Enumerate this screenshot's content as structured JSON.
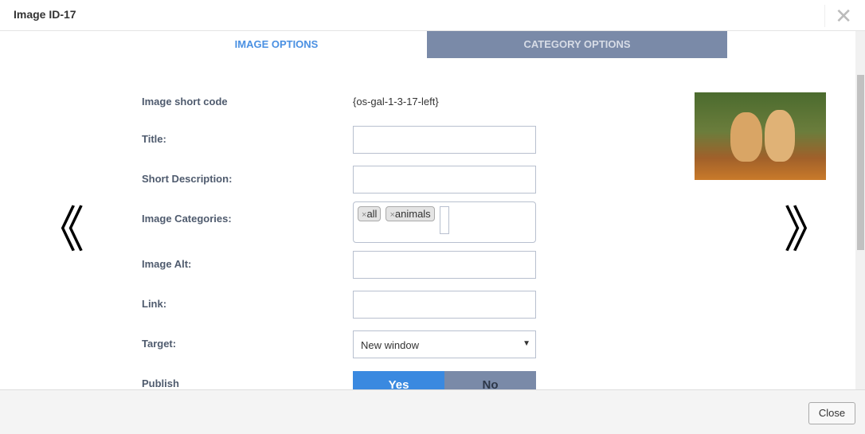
{
  "title": "Image ID-17",
  "tabs": [
    {
      "label": "IMAGE OPTIONS",
      "active": true
    },
    {
      "label": "CATEGORY OPTIONS",
      "active": false
    }
  ],
  "fields": {
    "short_code_label": "Image short code",
    "short_code": "{os-gal-1-3-17-left}",
    "title_label": "Title:",
    "title_value": "",
    "short_desc_label": "Short Description:",
    "short_desc_value": "",
    "categories_label": "Image Categories:",
    "categories": [
      "all",
      "animals"
    ],
    "alt_label": "Image Alt:",
    "alt_value": "",
    "link_label": "Link:",
    "link_value": "",
    "target_label": "Target:",
    "target_value": "New window",
    "publish_label": "Publish",
    "publish_yes": "Yes",
    "publish_no": "No",
    "publish_selected": "Yes"
  },
  "icons": {
    "prev": "«",
    "next": "»",
    "close": "✕",
    "remove": "×",
    "dropdown": "▼"
  },
  "colors": {
    "accent": "#3a89e0",
    "tab_inactive": "#7a8aa8"
  },
  "footer": {
    "close_label": "Close"
  }
}
